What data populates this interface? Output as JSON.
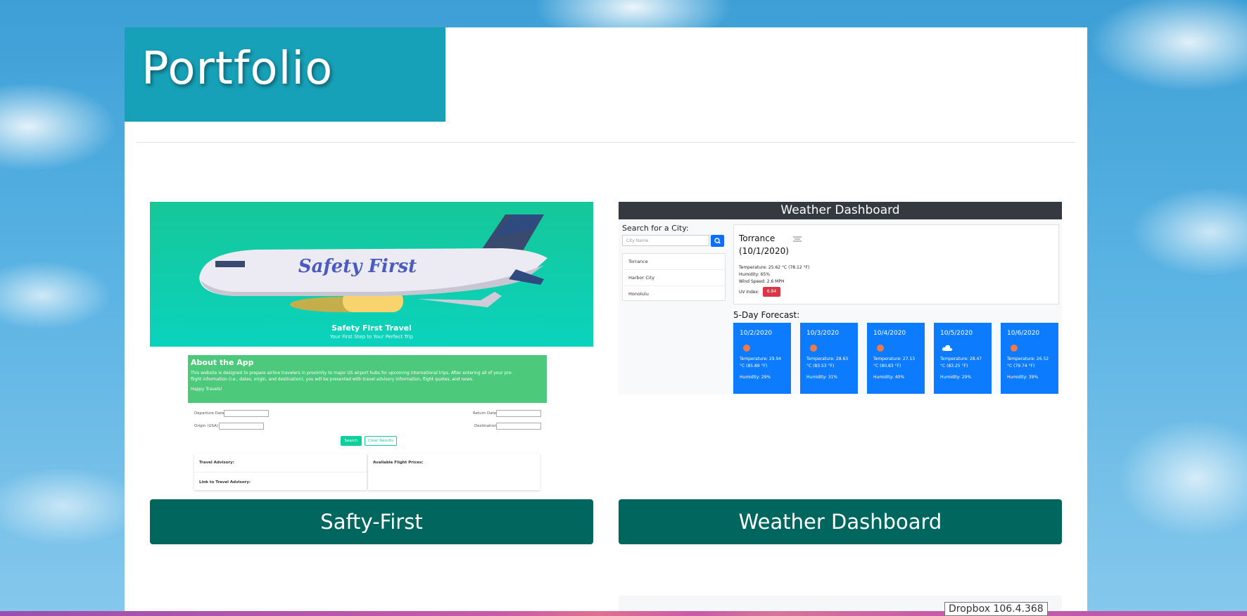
{
  "page": {
    "title": "Portfolio"
  },
  "projects": [
    {
      "button_label": "Safty-First",
      "preview": {
        "hero_logo": "Safety First",
        "hero_title": "Safety First Travel",
        "hero_subtitle": "Your First Step to Your Perfect Trip",
        "about_heading": "About the App",
        "about_text_1": "This website is designed to prepare airline travelers in proximity to major US airport hubs for upcoming international trips. After entering all of your pre-",
        "about_text_2": "flight information (i.e., dates, origin, and destination), you will be presented with travel advisory information, flight quotes, and news.",
        "about_text_3": "Happy Travels!",
        "departure_label": "Departure Date",
        "return_label": "Return Date",
        "origin_label": "Origin (USA)",
        "destination_label": "Destination",
        "search_label": "Search",
        "clear_label": "Clear Results",
        "advisory_label": "Travel Advisory:",
        "prices_label": "Available Flight Prices:",
        "link_label": "Link to Travel Advisory:"
      }
    },
    {
      "button_label": "Weather Dashboard",
      "preview": {
        "header": "Weather Dashboard",
        "search_label": "Search for a City:",
        "search_placeholder": "City Name",
        "history": [
          "Torrance",
          "Harbor City",
          "Honolulu"
        ],
        "city": "Torrance",
        "date": "(10/1/2020)",
        "temperature": "Temperature: 25.62 °C (78.12 °F)",
        "humidity": "Humidity: 65%",
        "wind": "Wind Speed: 2.6 MPH",
        "uv_label": "UV Index:",
        "uv_value": "6.84",
        "forecast_title": "5-Day Forecast:",
        "forecast": [
          {
            "date": "10/2/2020",
            "icon": "sun-icon",
            "temp_c": "Temperature: 29.94",
            "temp_f": "°C (85.89 °F)",
            "humidity": "Humidity: 29%"
          },
          {
            "date": "10/3/2020",
            "icon": "sun-icon",
            "temp_c": "Temperature: 28.63",
            "temp_f": "°C (83.53 °F)",
            "humidity": "Humidity: 31%"
          },
          {
            "date": "10/4/2020",
            "icon": "sun-icon",
            "temp_c": "Temperature: 27.13",
            "temp_f": "°C (80.83 °F)",
            "humidity": "Humidity: 40%"
          },
          {
            "date": "10/5/2020",
            "icon": "cloud-icon",
            "temp_c": "Temperature: 28.47",
            "temp_f": "°C (83.25 °F)",
            "humidity": "Humidity: 29%"
          },
          {
            "date": "10/6/2020",
            "icon": "sun-icon",
            "temp_c": "Temperature: 26.52",
            "temp_f": "°C (79.74 °F)",
            "humidity": "Humidity: 39%"
          }
        ]
      }
    }
  ],
  "tooltip": "Dropbox 106.4.368",
  "colors": {
    "title_bg": "#17a1b8",
    "button_bg": "#00665e",
    "forecast_bg": "#0d7bfd",
    "uv_badge": "#dc3545"
  }
}
